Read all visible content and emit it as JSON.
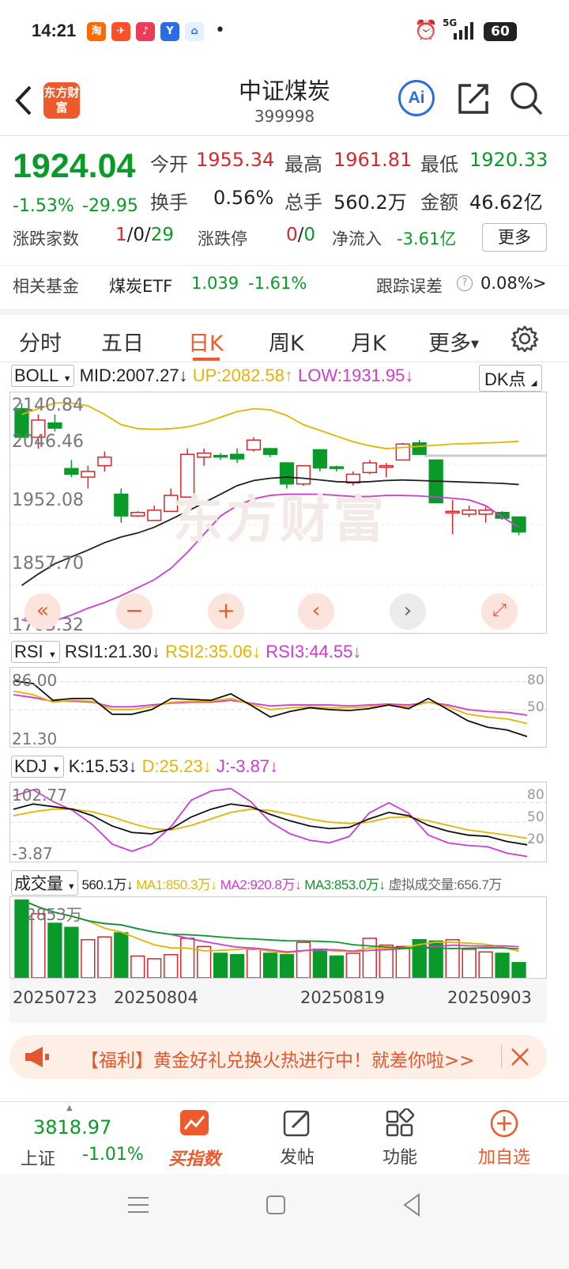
{
  "status": {
    "time": "14:21",
    "battery": "60",
    "network": "5G"
  },
  "header": {
    "title": "中证煤炭",
    "code": "399998",
    "logo_text": "东方财富",
    "ai_label": "Ai"
  },
  "quote": {
    "price": "1924.04",
    "change_pct": "-1.53%",
    "change": "-29.95",
    "open_label": "今开",
    "open": "1955.34",
    "high_label": "最高",
    "high": "1961.81",
    "low_label": "最低",
    "low": "1920.33",
    "turnover_label": "换手",
    "turnover": "0.56%",
    "volume_label": "总手",
    "volume": "560.2万",
    "amount_label": "金额",
    "amount": "46.62亿",
    "breadth_label": "涨跌家数",
    "breadth_up": "1",
    "breadth_flat": "0",
    "breadth_down": "29",
    "sep": "/",
    "limit_label": "涨跌停",
    "limit_up": "0",
    "limit_down": "0",
    "netflow_label": "净流入",
    "netflow": "-3.61亿",
    "more": "更多"
  },
  "fund": {
    "label": "相关基金",
    "name": "煤炭ETF",
    "price": "1.039",
    "pct": "-1.61%",
    "track_label": "跟踪误差",
    "track": "0.08%",
    "arrow": ">"
  },
  "tabs": [
    {
      "label": "分时"
    },
    {
      "label": "五日"
    },
    {
      "label": "日K"
    },
    {
      "label": "周K"
    },
    {
      "label": "月K"
    },
    {
      "label": "更多"
    }
  ],
  "boll": {
    "name": "BOLL",
    "mid": "MID:2007.27↓",
    "up": "UP:2082.58↑",
    "low": "LOW:1931.95↓",
    "dk": "DK点",
    "yticks": [
      "2140.84",
      "2046.46",
      "1952.08",
      "1857.70",
      "1763.32"
    ]
  },
  "rsi": {
    "name": "RSI",
    "r1": "RSI1:21.30↓",
    "r2": "RSI2:35.06↓",
    "r3": "RSI3:44.55↓",
    "top": "86.00",
    "bottom": "21.30",
    "lv80": "80",
    "lv50": "50"
  },
  "kdj": {
    "name": "KDJ",
    "k": "K:15.53↓",
    "d": "D:25.23↓",
    "j": "J:-3.87↓",
    "top": "102.77",
    "bottom": "-3.87",
    "lv80": "80",
    "lv50": "50",
    "lv20": "20"
  },
  "vol": {
    "name": "成交量",
    "v": "560.1万↓",
    "ma1": "MA1:850.3万↓",
    "ma2": "MA2:920.8万↓",
    "ma3": "MA3:853.0万↓",
    "virt": "虚拟成交量:656.7万",
    "top": "2853万"
  },
  "dates": [
    "20250723",
    "20250804",
    "20250819",
    "20250903"
  ],
  "watermark": "东方财富",
  "banner": {
    "text": "【福利】黄金好礼兑换火热进行中！就差你啦>>"
  },
  "nav": {
    "index_val": "3818.97",
    "index_name": "上证",
    "index_pct": "-1.01%",
    "buy": "买指数",
    "post": "发帖",
    "func": "功能",
    "add": "加自选"
  },
  "colors": {
    "up": "#d9272e",
    "down": "#0a9a2a",
    "accent": "#ef5a2c",
    "mid": "#222222",
    "upper": "#e8b400",
    "lower": "#d23bd2"
  },
  "chart_data": {
    "type": "candlestick",
    "candles": [
      [
        2140,
        2150,
        2100,
        2090
      ],
      [
        2090,
        2130,
        2070,
        2120
      ],
      [
        2115,
        2130,
        2100,
        2106
      ],
      [
        2035,
        2050,
        2020,
        2025
      ],
      [
        2020,
        2040,
        2000,
        2030
      ],
      [
        2040,
        2065,
        2030,
        2055
      ],
      [
        1990,
        2000,
        1940,
        1952
      ],
      [
        1952,
        1960,
        1950,
        1958
      ],
      [
        1944,
        1970,
        1944,
        1962
      ],
      [
        1960,
        2000,
        1960,
        1988
      ],
      [
        1985,
        2070,
        1985,
        2060
      ],
      [
        2055,
        2070,
        2040,
        2062
      ],
      [
        2058,
        2062,
        2050,
        2056
      ],
      [
        2060,
        2070,
        2045,
        2052
      ],
      [
        2068,
        2090,
        2065,
        2085
      ],
      [
        2070,
        2070,
        2055,
        2060
      ],
      [
        2045,
        2045,
        2000,
        2008
      ],
      [
        2008,
        2040,
        2005,
        2040
      ],
      [
        2068,
        2068,
        2030,
        2036
      ],
      [
        2038,
        2040,
        2030,
        2036
      ],
      [
        2010,
        2030,
        2005,
        2025
      ],
      [
        2028,
        2050,
        2025,
        2045
      ],
      [
        2040,
        2045,
        2020,
        2040
      ],
      [
        2050,
        2080,
        2050,
        2078
      ],
      [
        2080,
        2085,
        2060,
        2060
      ],
      [
        2050,
        2050,
        1980,
        1975
      ],
      [
        1960,
        1980,
        1920,
        1960
      ],
      [
        1955,
        1970,
        1950,
        1962
      ],
      [
        1955,
        1968,
        1940,
        1962
      ],
      [
        1958,
        1960,
        1945,
        1948
      ],
      [
        1950,
        1950,
        1918,
        1924
      ]
    ],
    "rsi1": [
      81,
      78,
      60,
      62,
      62,
      45,
      45,
      50,
      62,
      61,
      60,
      67,
      55,
      42,
      48,
      52,
      50,
      49,
      51,
      55,
      51,
      62,
      50,
      38,
      31,
      28,
      21
    ],
    "rsi2": [
      70,
      66,
      58,
      60,
      59,
      50,
      50,
      53,
      58,
      59,
      59,
      62,
      56,
      50,
      52,
      53,
      52,
      52,
      53,
      55,
      53,
      58,
      53,
      45,
      42,
      40,
      35
    ],
    "rsi3": [
      66,
      63,
      59,
      59,
      58,
      53,
      53,
      55,
      57,
      58,
      58,
      60,
      57,
      54,
      55,
      55,
      55,
      54,
      55,
      56,
      55,
      58,
      55,
      50,
      48,
      47,
      44
    ],
    "k": [
      70,
      78,
      74,
      70,
      60,
      44,
      34,
      32,
      40,
      58,
      70,
      78,
      74,
      62,
      52,
      44,
      40,
      42,
      55,
      65,
      60,
      45,
      36,
      30,
      28,
      20,
      15
    ],
    "d": [
      60,
      66,
      70,
      70,
      66,
      58,
      48,
      40,
      38,
      45,
      55,
      65,
      70,
      68,
      62,
      55,
      50,
      48,
      50,
      57,
      58,
      52,
      45,
      38,
      34,
      30,
      25
    ],
    "j": [
      90,
      100,
      82,
      68,
      46,
      16,
      5,
      16,
      44,
      84,
      98,
      102,
      82,
      50,
      32,
      22,
      18,
      28,
      64,
      80,
      64,
      30,
      18,
      14,
      12,
      2,
      -3
    ],
    "volume": [
      2853,
      2350,
      2000,
      1850,
      1400,
      1500,
      1650,
      800,
      700,
      850,
      1450,
      1150,
      900,
      850,
      1050,
      900,
      850,
      1300,
      1050,
      800,
      900,
      1450,
      1200,
      1150,
      1400,
      1350,
      1400,
      1050,
      950,
      900,
      560
    ],
    "upper": [
      2130,
      2140,
      2150,
      2150,
      2145,
      2130,
      2112,
      2105,
      2104,
      2105,
      2108,
      2115,
      2125,
      2135,
      2140,
      2138,
      2128,
      2112,
      2102,
      2092,
      2082,
      2075,
      2070,
      2072,
      2074,
      2076,
      2078,
      2079,
      2080,
      2081,
      2083
    ],
    "mid": [
      1830,
      1850,
      1868,
      1880,
      1892,
      1905,
      1915,
      1922,
      1932,
      1946,
      1960,
      1975,
      1990,
      2005,
      2014,
      2018,
      2020,
      2018,
      2015,
      2012,
      2011,
      2012,
      2014,
      2015,
      2014,
      2013,
      2012,
      2011,
      2010,
      2009,
      2007
    ],
    "lower": [
      1770,
      1764,
      1768,
      1778,
      1790,
      1800,
      1812,
      1826,
      1840,
      1860,
      1888,
      1920,
      1952,
      1970,
      1982,
      1988,
      1990,
      1990,
      1990,
      1988,
      1986,
      1986,
      1988,
      1988,
      1987,
      1985,
      1983,
      1980,
      1970,
      1950,
      1932
    ],
    "ylim": [
      1763.32,
      2140.84
    ],
    "dates": [
      "20250723",
      "20250804",
      "20250819",
      "20250903"
    ]
  }
}
